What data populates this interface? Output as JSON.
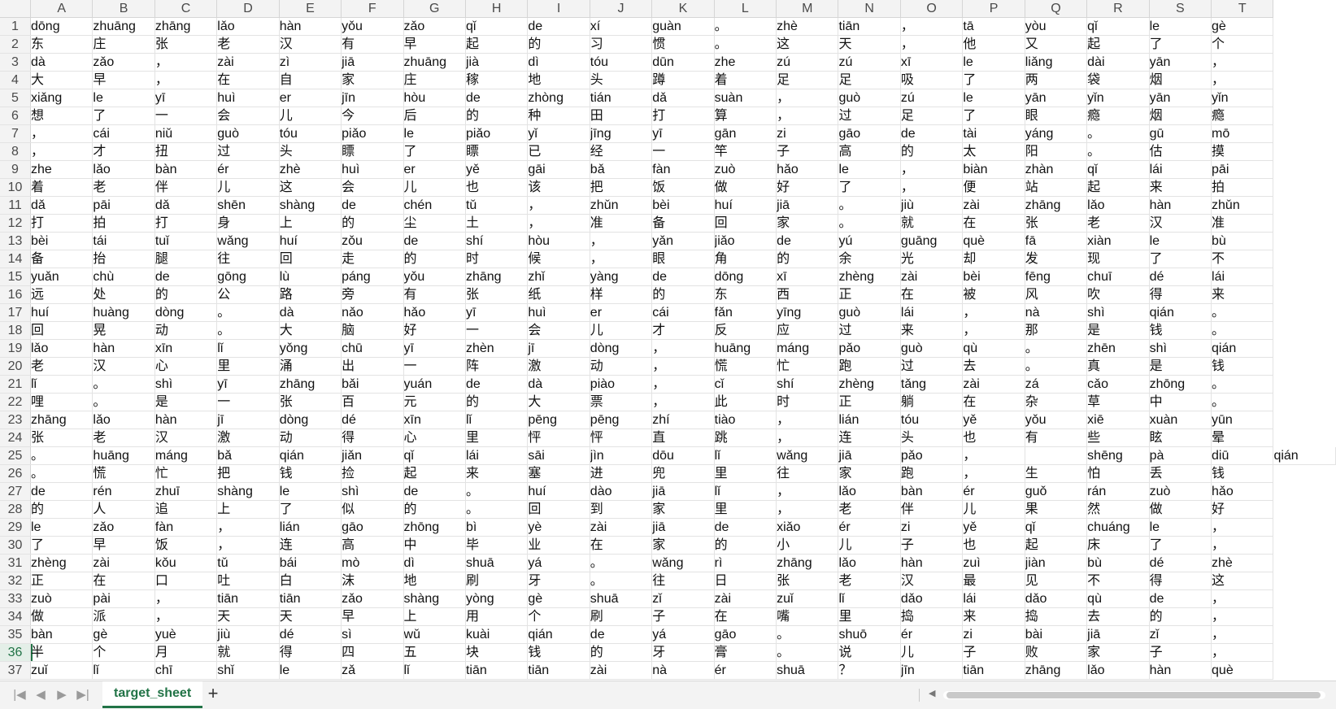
{
  "columns": [
    "A",
    "B",
    "C",
    "D",
    "E",
    "F",
    "G",
    "H",
    "I",
    "J",
    "K",
    "L",
    "M",
    "N",
    "O",
    "P",
    "Q",
    "R",
    "S",
    "T"
  ],
  "rows": [
    {
      "num": "1",
      "cells": [
        "dōng",
        "zhuāng",
        "zhāng",
        "lǎo",
        "hàn",
        "yǒu",
        "zǎo",
        "qǐ",
        "de",
        "xí",
        "guàn",
        "。",
        "zhè",
        "tiān",
        "，",
        "tā",
        "yòu",
        "qǐ",
        "le",
        "gè"
      ]
    },
    {
      "num": "2",
      "cells": [
        "东",
        "庄",
        "张",
        "老",
        "汉",
        "有",
        "早",
        "起",
        "的",
        "习",
        "惯",
        "。",
        "这",
        "天",
        "，",
        "他",
        "又",
        "起",
        "了",
        "个"
      ]
    },
    {
      "num": "3",
      "cells": [
        "dà",
        "zǎo",
        "，",
        "zài",
        "zì",
        "jiā",
        "zhuāng",
        "jià",
        "dì",
        "tóu",
        "dūn",
        "zhe",
        "zú",
        "zú",
        "xī",
        "le",
        "liǎng",
        "dài",
        "yān",
        "，"
      ]
    },
    {
      "num": "4",
      "cells": [
        "大",
        "早",
        "，",
        "在",
        "自",
        "家",
        "庄",
        "稼",
        "地",
        "头",
        "蹲",
        "着",
        "足",
        "足",
        "吸",
        "了",
        "两",
        "袋",
        "烟",
        "，"
      ]
    },
    {
      "num": "5",
      "cells": [
        "xiǎng",
        "le",
        "yī",
        "huì",
        "er",
        "jīn",
        "hòu",
        "de",
        "zhòng",
        "tián",
        "dǎ",
        "suàn",
        "，",
        "guò",
        "zú",
        "le",
        "yān",
        "yǐn",
        "yān",
        "yǐn"
      ]
    },
    {
      "num": "6",
      "cells": [
        "想",
        "了",
        "一",
        "会",
        "儿",
        "今",
        "后",
        "的",
        "种",
        "田",
        "打",
        "算",
        "，",
        "过",
        "足",
        "了",
        "眼",
        "瘾",
        "烟",
        "瘾"
      ]
    },
    {
      "num": "7",
      "cells": [
        "，",
        "cái",
        "niǔ",
        "guò",
        "tóu",
        "piǎo",
        "le",
        "piǎo",
        "yǐ",
        "jīng",
        "yī",
        "gān",
        "zi",
        "gāo",
        "de",
        "tài",
        "yáng",
        "。",
        "gū",
        "mō"
      ]
    },
    {
      "num": "8",
      "cells": [
        "，",
        "才",
        "扭",
        "过",
        "头",
        "瞟",
        "了",
        "瞟",
        "已",
        "经",
        "一",
        "竿",
        "子",
        "高",
        "的",
        "太",
        "阳",
        "。",
        "估",
        "摸"
      ]
    },
    {
      "num": "9",
      "cells": [
        "zhe",
        "lǎo",
        "bàn",
        "ér",
        "zhè",
        "huì",
        "er",
        "yě",
        "gāi",
        "bǎ",
        "fàn",
        "zuò",
        "hǎo",
        "le",
        "，",
        "biàn",
        "zhàn",
        "qǐ",
        "lái",
        "pāi"
      ]
    },
    {
      "num": "10",
      "cells": [
        "着",
        "老",
        "伴",
        "儿",
        "这",
        "会",
        "儿",
        "也",
        "该",
        "把",
        "饭",
        "做",
        "好",
        "了",
        "，",
        "便",
        "站",
        "起",
        "来",
        "拍"
      ]
    },
    {
      "num": "11",
      "cells": [
        "dǎ",
        "pāi",
        "dǎ",
        "shēn",
        "shàng",
        "de",
        "chén",
        "tǔ",
        "，",
        "zhǔn",
        "bèi",
        "huí",
        "jiā",
        "。",
        "jiù",
        "zài",
        "zhāng",
        "lǎo",
        "hàn",
        "zhǔn"
      ]
    },
    {
      "num": "12",
      "cells": [
        "打",
        "拍",
        "打",
        "身",
        "上",
        "的",
        "尘",
        "土",
        "，",
        "准",
        "备",
        "回",
        "家",
        "。",
        "就",
        "在",
        "张",
        "老",
        "汉",
        "准"
      ]
    },
    {
      "num": "13",
      "cells": [
        "bèi",
        "tái",
        "tuǐ",
        "wǎng",
        "huí",
        "zǒu",
        "de",
        "shí",
        "hòu",
        "，",
        "yǎn",
        "jiǎo",
        "de",
        "yú",
        "guāng",
        "què",
        "fā",
        "xiàn",
        "le",
        "bù"
      ]
    },
    {
      "num": "14",
      "cells": [
        "备",
        "抬",
        "腿",
        "往",
        "回",
        "走",
        "的",
        "时",
        "候",
        "，",
        "眼",
        "角",
        "的",
        "余",
        "光",
        "却",
        "发",
        "现",
        "了",
        "不"
      ]
    },
    {
      "num": "15",
      "cells": [
        "yuǎn",
        "chù",
        "de",
        "gōng",
        "lù",
        "páng",
        "yǒu",
        "zhāng",
        "zhǐ",
        "yàng",
        "de",
        "dōng",
        "xī",
        "zhèng",
        "zài",
        "bèi",
        "fēng",
        "chuī",
        "dé",
        "lái"
      ]
    },
    {
      "num": "16",
      "cells": [
        "远",
        "处",
        "的",
        "公",
        "路",
        "旁",
        "有",
        "张",
        "纸",
        "样",
        "的",
        "东",
        "西",
        "正",
        "在",
        "被",
        "风",
        "吹",
        "得",
        "来"
      ]
    },
    {
      "num": "17",
      "cells": [
        "huí",
        "huàng",
        "dòng",
        "。",
        "dà",
        "nǎo",
        "hǎo",
        "yī",
        "huì",
        "er",
        "cái",
        "fǎn",
        "yīng",
        "guò",
        "lái",
        "，",
        "nà",
        "shì",
        "qián",
        "。"
      ]
    },
    {
      "num": "18",
      "cells": [
        "回",
        "晃",
        "动",
        "。",
        "大",
        "脑",
        "好",
        "一",
        "会",
        "儿",
        "才",
        "反",
        "应",
        "过",
        "来",
        "，",
        "那",
        "是",
        "钱",
        "。"
      ]
    },
    {
      "num": "19",
      "cells": [
        "lǎo",
        "hàn",
        "xīn",
        "lǐ",
        "yǒng",
        "chū",
        "yī",
        "zhèn",
        "jī",
        "dòng",
        "，",
        "huāng",
        "máng",
        "pǎo",
        "guò",
        "qù",
        "。",
        "zhēn",
        "shì",
        "qián"
      ]
    },
    {
      "num": "20",
      "cells": [
        "老",
        "汉",
        "心",
        "里",
        "涌",
        "出",
        "一",
        "阵",
        "激",
        "动",
        "，",
        "慌",
        "忙",
        "跑",
        "过",
        "去",
        "。",
        "真",
        "是",
        "钱"
      ]
    },
    {
      "num": "21",
      "cells": [
        "lǐ",
        "。",
        "shì",
        "yī",
        "zhāng",
        "bǎi",
        "yuán",
        "de",
        "dà",
        "piào",
        "，",
        "cǐ",
        "shí",
        "zhèng",
        "tǎng",
        "zài",
        "zá",
        "cǎo",
        "zhōng",
        "。"
      ]
    },
    {
      "num": "22",
      "cells": [
        "哩",
        "。",
        "是",
        "一",
        "张",
        "百",
        "元",
        "的",
        "大",
        "票",
        "，",
        "此",
        "时",
        "正",
        "躺",
        "在",
        "杂",
        "草",
        "中",
        "。"
      ]
    },
    {
      "num": "23",
      "cells": [
        "zhāng",
        "lǎo",
        "hàn",
        "jī",
        "dòng",
        "dé",
        "xīn",
        "lǐ",
        "pēng",
        "pēng",
        "zhí",
        "tiào",
        "，",
        "lián",
        "tóu",
        "yě",
        "yǒu",
        "xiē",
        "xuàn",
        "yūn"
      ]
    },
    {
      "num": "24",
      "cells": [
        "张",
        "老",
        "汉",
        "激",
        "动",
        "得",
        "心",
        "里",
        "怦",
        "怦",
        "直",
        "跳",
        "，",
        "连",
        "头",
        "也",
        "有",
        "些",
        "眩",
        "晕"
      ]
    },
    {
      "num": "25",
      "cells": [
        "。",
        "huāng",
        "máng",
        "bǎ",
        "qián",
        "jiǎn",
        "qǐ",
        "lái",
        "sāi",
        "jìn",
        "dōu",
        "lǐ",
        "wǎng",
        "jiā",
        "pǎo",
        "，",
        "",
        "shēng",
        "pà",
        "diū",
        "qián"
      ]
    },
    {
      "num": "26",
      "cells": [
        "。",
        "慌",
        "忙",
        "把",
        "钱",
        "捡",
        "起",
        "来",
        "塞",
        "进",
        "兜",
        "里",
        "往",
        "家",
        "跑",
        "，",
        "生",
        "怕",
        "丢",
        "钱"
      ]
    },
    {
      "num": "27",
      "cells": [
        "de",
        "rén",
        "zhuī",
        "shàng",
        "le",
        "shì",
        "de",
        "。",
        "huí",
        "dào",
        "jiā",
        "lǐ",
        "，",
        "lǎo",
        "bàn",
        "ér",
        "guǒ",
        "rán",
        "zuò",
        "hǎo"
      ]
    },
    {
      "num": "28",
      "cells": [
        "的",
        "人",
        "追",
        "上",
        "了",
        "似",
        "的",
        "。",
        "回",
        "到",
        "家",
        "里",
        "，",
        "老",
        "伴",
        "儿",
        "果",
        "然",
        "做",
        "好"
      ]
    },
    {
      "num": "29",
      "cells": [
        "le",
        "zǎo",
        "fàn",
        "，",
        "lián",
        "gāo",
        "zhōng",
        "bì",
        "yè",
        "zài",
        "jiā",
        "de",
        "xiǎo",
        "ér",
        "zi",
        "yě",
        "qǐ",
        "chuáng",
        "le",
        "，"
      ]
    },
    {
      "num": "30",
      "cells": [
        "了",
        "早",
        "饭",
        "，",
        "连",
        "高",
        "中",
        "毕",
        "业",
        "在",
        "家",
        "的",
        "小",
        "儿",
        "子",
        "也",
        "起",
        "床",
        "了",
        "，"
      ]
    },
    {
      "num": "31",
      "cells": [
        "zhèng",
        "zài",
        "kǒu",
        "tǔ",
        "bái",
        "mò",
        "dì",
        "shuā",
        "yá",
        "。",
        "wǎng",
        "rì",
        "zhāng",
        "lǎo",
        "hàn",
        "zuì",
        "jiàn",
        "bù",
        "dé",
        "zhè"
      ]
    },
    {
      "num": "32",
      "cells": [
        "正",
        "在",
        "口",
        "吐",
        "白",
        "沫",
        "地",
        "刷",
        "牙",
        "。",
        "往",
        "日",
        "张",
        "老",
        "汉",
        "最",
        "见",
        "不",
        "得",
        "这"
      ]
    },
    {
      "num": "33",
      "cells": [
        "zuò",
        "pài",
        "，",
        "tiān",
        "tiān",
        "zǎo",
        "shàng",
        "yòng",
        "gè",
        "shuā",
        "zǐ",
        "zài",
        "zuǐ",
        "lǐ",
        "dǎo",
        "lái",
        "dǎo",
        "qù",
        "de",
        "，"
      ]
    },
    {
      "num": "34",
      "cells": [
        "做",
        "派",
        "，",
        "天",
        "天",
        "早",
        "上",
        "用",
        "个",
        "刷",
        "子",
        "在",
        "嘴",
        "里",
        "捣",
        "来",
        "捣",
        "去",
        "的",
        "，"
      ]
    },
    {
      "num": "35",
      "cells": [
        "bàn",
        "gè",
        "yuè",
        "jiù",
        "dé",
        "sì",
        "wǔ",
        "kuài",
        "qián",
        "de",
        "yá",
        "gāo",
        "。",
        "shuō",
        "ér",
        "zi",
        "bài",
        "jiā",
        "zǐ",
        "，"
      ]
    },
    {
      "num": "36",
      "cells": [
        "半",
        "个",
        "月",
        "就",
        "得",
        "四",
        "五",
        "块",
        "钱",
        "的",
        "牙",
        "膏",
        "。",
        "说",
        "儿",
        "子",
        "败",
        "家",
        "子",
        "，"
      ]
    },
    {
      "num": "37",
      "cells": [
        "zuǐ",
        "lǐ",
        "chī",
        "shǐ",
        "le",
        "zǎ",
        "lǐ",
        "tiān",
        "tiān",
        "zài",
        "nà",
        "ér",
        "shuā",
        "？",
        "jīn",
        "tiān",
        "zhāng",
        "lǎo",
        "hàn",
        "què"
      ]
    }
  ],
  "active_row": "36",
  "tab_bar": {
    "nav_first": "|◀",
    "nav_prev": "◀",
    "nav_next": "▶",
    "nav_last": "▶|",
    "sheet_tab": "target_sheet",
    "add_sheet": "+"
  },
  "colors": {
    "accent": "#217346",
    "header_bg": "#f3f3f3",
    "grid_line": "#e3e3e3"
  }
}
